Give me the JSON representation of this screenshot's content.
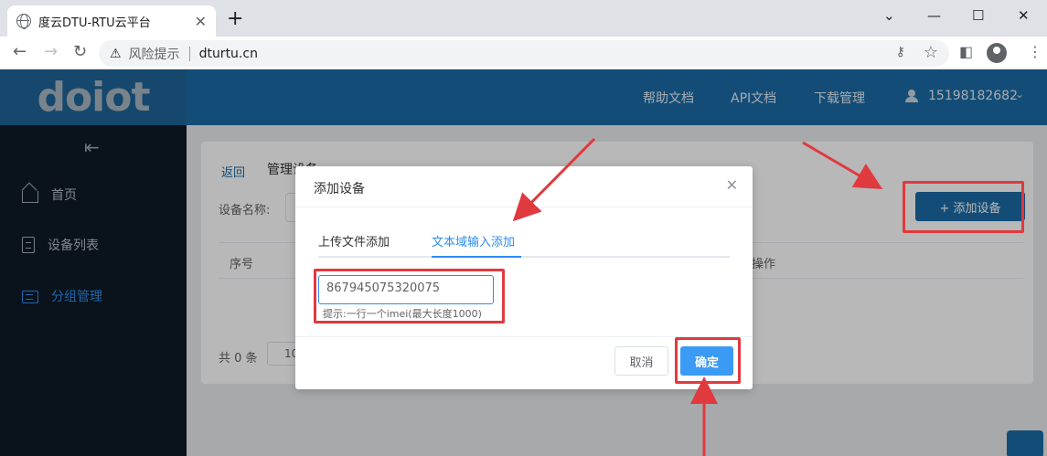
{
  "browser": {
    "tab_title": "度云DTU-RTU云平台",
    "tab_close": "✕",
    "new_tab": "+",
    "win_min": "⌄",
    "win_minimize": "—",
    "win_max": "☐",
    "win_close": "✕",
    "risk_label": "风险提示",
    "url": "dturtu.cn"
  },
  "header": {
    "logo": "doiot",
    "nav": [
      "帮助文档",
      "API文档",
      "下载管理"
    ],
    "user": "15198182682"
  },
  "sidebar": {
    "items": [
      {
        "label": "首页"
      },
      {
        "label": "设备列表"
      },
      {
        "label": "分组管理"
      }
    ]
  },
  "content": {
    "back": "返回",
    "title": "管理设备",
    "filter_label": "设备名称:",
    "add_button": "+ 添加设备",
    "columns": [
      "序号",
      "操作"
    ],
    "total": "共 0 条",
    "page_size": "10"
  },
  "dialog": {
    "title": "添加设备",
    "close": "✕",
    "tabs": [
      "上传文件添加",
      "文本域输入添加"
    ],
    "active_tab": 1,
    "imei_value": "867945075320075",
    "hint": "提示:一行一个imei(最大长度1000)",
    "cancel": "取消",
    "confirm": "确定"
  },
  "colors": {
    "header_blue": "#1b6ba6",
    "sidebar_dark": "#0f1b28",
    "primary": "#2d8cf0",
    "annotation_red": "#e0393e"
  }
}
